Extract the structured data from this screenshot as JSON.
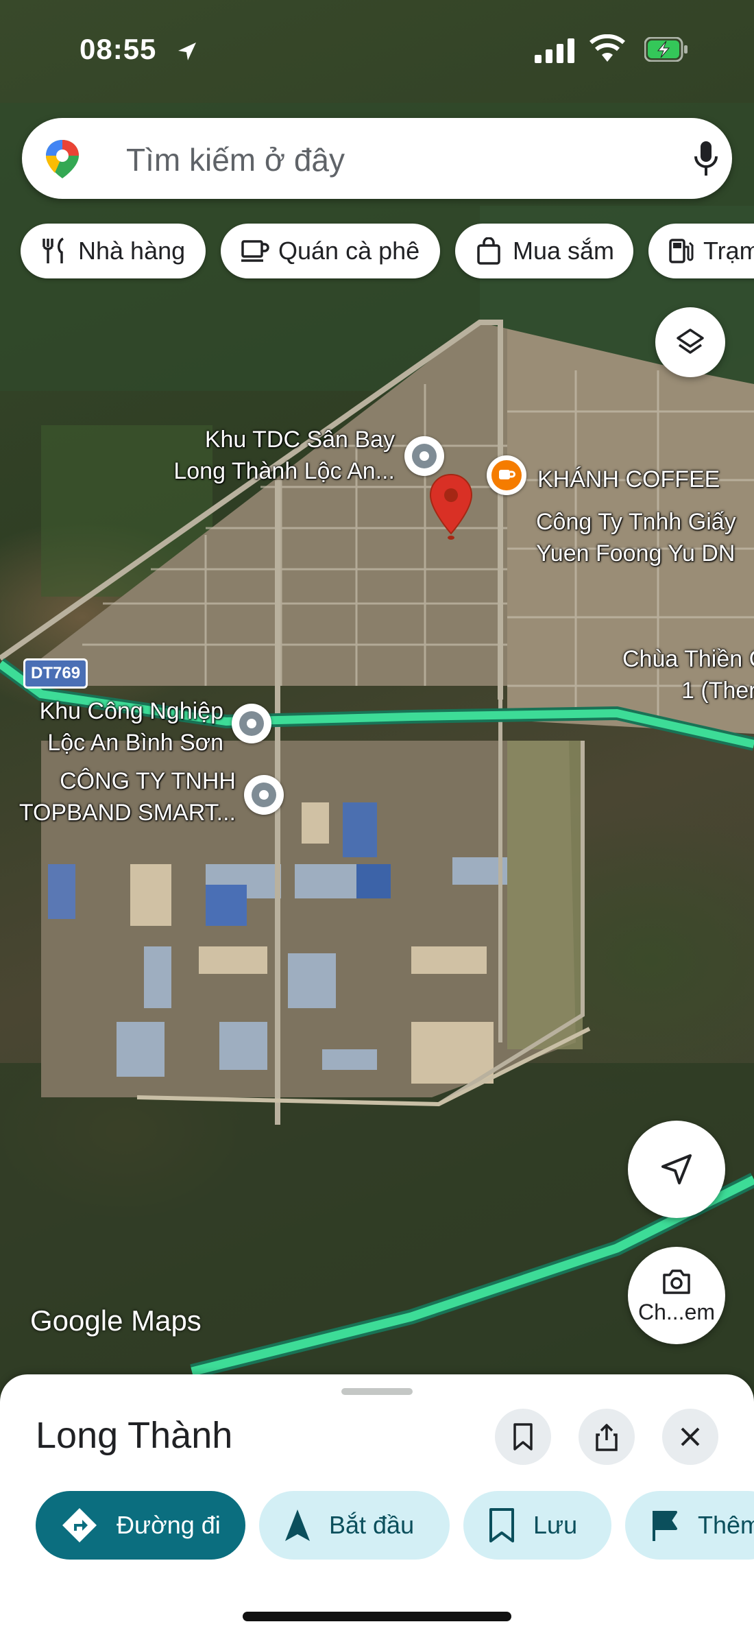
{
  "status_bar": {
    "time": "08:55"
  },
  "search": {
    "placeholder": "Tìm kiếm ở đây"
  },
  "chips": [
    {
      "label": "Nhà hàng",
      "icon": "restaurant-icon"
    },
    {
      "label": "Quán cà phê",
      "icon": "coffee-icon"
    },
    {
      "label": "Mua sắm",
      "icon": "shopping-bag-icon"
    },
    {
      "label": "Trạm",
      "icon": "gas-station-icon"
    }
  ],
  "map": {
    "road_shield": "DT769",
    "watermark": "Google Maps",
    "labels": {
      "tdc": [
        "Khu TDC Sân Bay",
        "Long Thành Lộc An..."
      ],
      "coffee": "KHÁNH COFFEE",
      "paper": [
        "Công Ty Tnhh Giấy",
        "Yuen Foong Yu DN"
      ],
      "temple": [
        "Chùa Thiền C",
        "1 (Ther"
      ],
      "kcn": [
        "Khu Công Nghiệp",
        "Lộc An Bình Sơn"
      ],
      "topband": [
        "CÔNG TY TNHH",
        "TOPBAND SMART..."
      ]
    },
    "camera_button": "Ch...em",
    "colors": {
      "highlight_road": "#3ddc97",
      "pin": "#d93025",
      "coffee_poi": "#f57c00"
    }
  },
  "sheet": {
    "title": "Long Thành",
    "actions": [
      {
        "label": "Đường đi",
        "icon": "directions-icon"
      },
      {
        "label": "Bắt đầu",
        "icon": "navigation-arrow-icon"
      },
      {
        "label": "Lưu",
        "icon": "bookmark-icon"
      },
      {
        "label": "Thêm",
        "icon": "flag-icon"
      }
    ],
    "colors": {
      "primary": "#0b6e7f",
      "secondary_bg": "#d3eff5"
    }
  }
}
